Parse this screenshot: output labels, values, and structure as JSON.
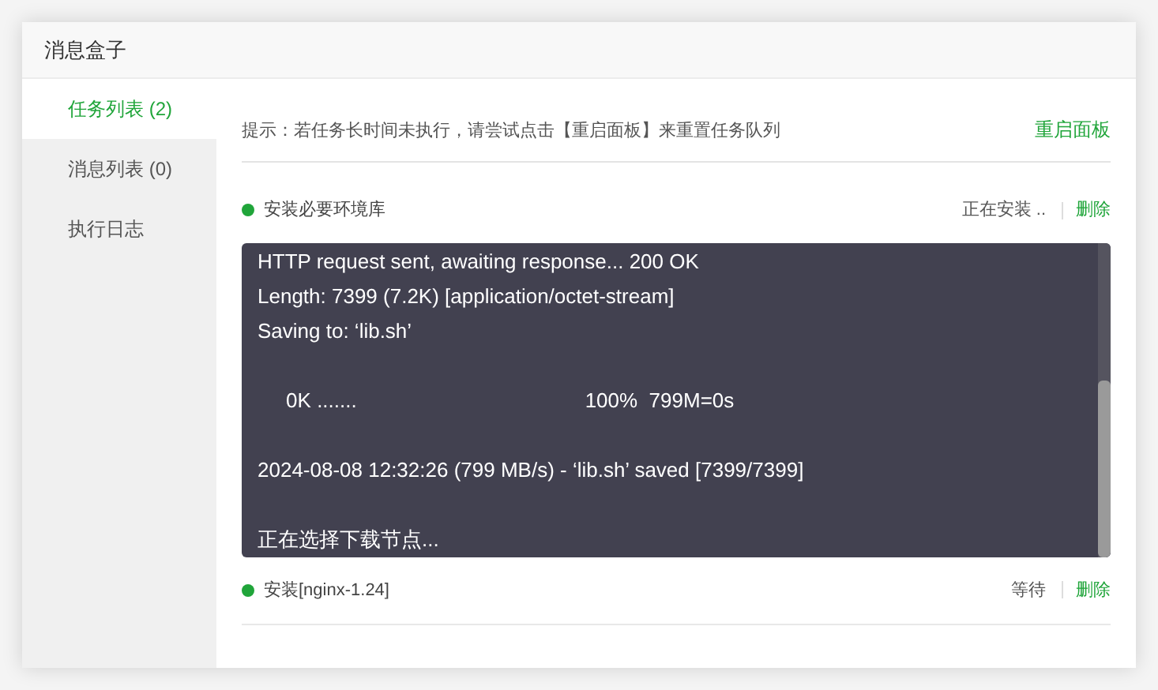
{
  "window": {
    "title": "消息盒子"
  },
  "sidebar": {
    "items": [
      {
        "label": "任务列表 (2)",
        "selected": true
      },
      {
        "label": "消息列表 (0)",
        "selected": false
      },
      {
        "label": "执行日志",
        "selected": false
      }
    ]
  },
  "hint": {
    "text": "提示：若任务长时间未执行，请尝试点击【重启面板】来重置任务队列",
    "action": "重启面板"
  },
  "tasks": [
    {
      "name": "安装必要环境库",
      "status": "正在安装 ..",
      "delete": "删除",
      "color": "#20a53a",
      "log": "HTTP request sent, awaiting response... 200 OK\nLength: 7399 (7.2K) [application/octet-stream]\nSaving to: ‘lib.sh’\n\n     0K .......                                        100%  799M=0s\n\n2024-08-08 12:32:26 (799 MB/s) - ‘lib.sh’ saved [7399/7399]\n\n正在选择下载节点..."
    },
    {
      "name": "安装[nginx-1.24]",
      "status": "等待",
      "delete": "删除",
      "color": "#20a53a"
    }
  ]
}
